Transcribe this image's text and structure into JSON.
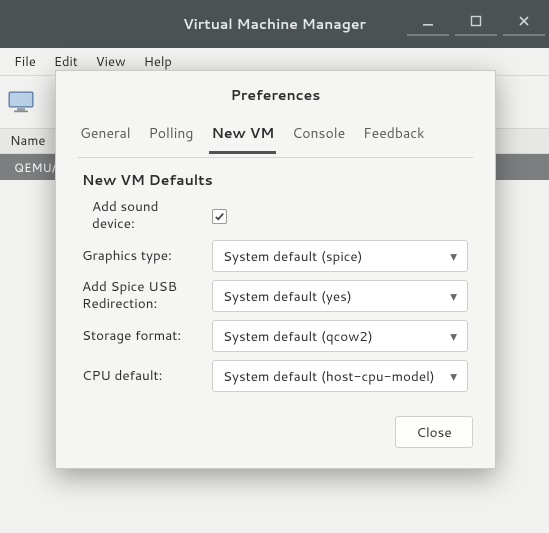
{
  "window": {
    "title": "Virtual Machine Manager"
  },
  "menubar": {
    "file": "File",
    "edit": "Edit",
    "view": "View",
    "help": "Help"
  },
  "list": {
    "header_name": "Name",
    "row0": "QEMU/"
  },
  "dialog": {
    "title": "Preferences",
    "tabs": {
      "general": "General",
      "polling": "Polling",
      "new_vm": "New VM",
      "console": "Console",
      "feedback": "Feedback"
    },
    "section_head": "New VM Defaults",
    "fields": {
      "sound_label": "Add sound device:",
      "graphics_label": "Graphics type:",
      "graphics_value": "System default (spice)",
      "spiceusb_label": "Add Spice USB Redirection:",
      "spiceusb_value": "System default (yes)",
      "storage_label": "Storage format:",
      "storage_value": "System default (qcow2)",
      "cpu_label": "CPU default:",
      "cpu_value": "System default (host-cpu-model)"
    },
    "close": "Close"
  }
}
